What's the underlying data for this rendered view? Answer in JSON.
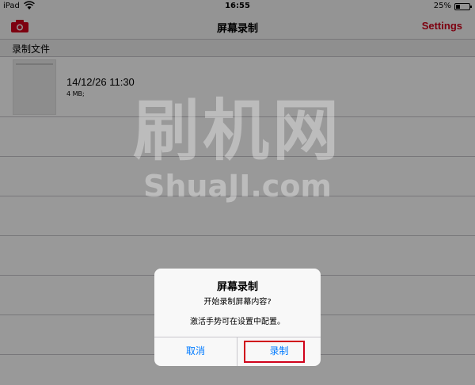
{
  "status_bar": {
    "carrier": "iPad",
    "time": "16:55",
    "battery": "25%",
    "battery_level": 0.25
  },
  "nav": {
    "title": "屏幕录制",
    "settings_label": "Settings",
    "camera_icon": "camera-icon",
    "accent_color": "#d0021b"
  },
  "section": {
    "header": "录制文件"
  },
  "files": [
    {
      "date": "14/12/26 11:30",
      "size": "4 MB;"
    }
  ],
  "watermark": {
    "cn": "刷机网",
    "en": "ShuaJI.com"
  },
  "alert": {
    "title": "屏幕录制",
    "message": "开始录制屏幕内容?",
    "hint": "激活手势可在设置中配置。",
    "cancel_label": "取消",
    "record_label": "录制",
    "button_color": "#007aff"
  }
}
